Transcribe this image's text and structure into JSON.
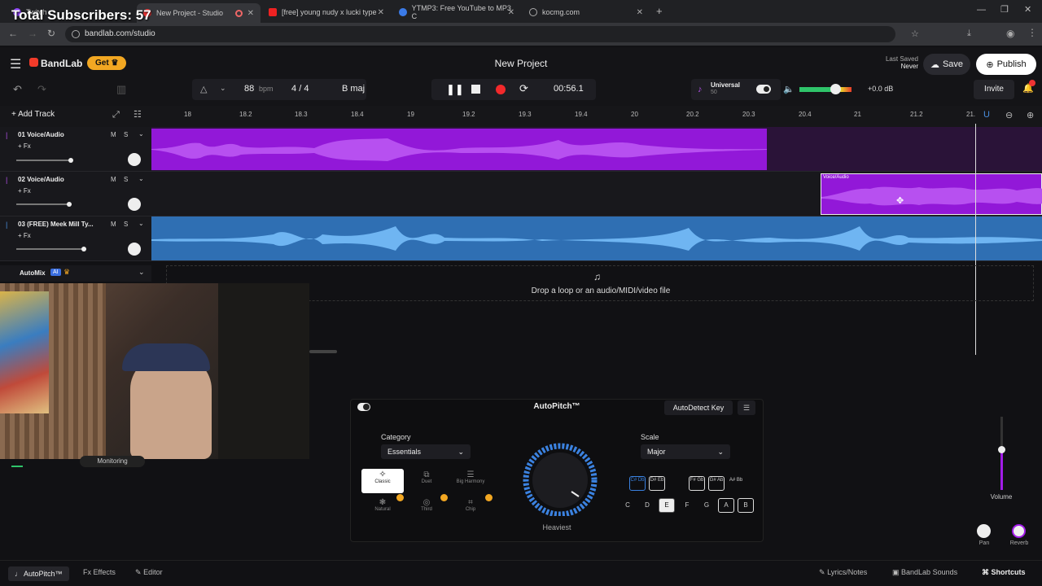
{
  "overlay": {
    "subscribers": "Total Subscribers: 57"
  },
  "browser": {
    "tabs": [
      {
        "label": "Twitch"
      },
      {
        "label": "New Project - Studio"
      },
      {
        "label": "[free] young nudy x lucki type"
      },
      {
        "label": "YTMP3: Free YouTube to MP3 C"
      },
      {
        "label": "kocmg.com"
      }
    ],
    "url": "bandlab.com/studio"
  },
  "app": {
    "brand": "BandLab",
    "get_label": "Get",
    "project_title": "New Project",
    "last_saved_label": "Last Saved",
    "last_saved_value": "Never",
    "save": "Save",
    "publish": "Publish",
    "invite": "Invite"
  },
  "transport": {
    "bpm": "88",
    "bpm_unit": "bpm",
    "sig_num": "4",
    "sig_sep": "/",
    "sig_den": "4",
    "key": "B maj",
    "time": "00:56.1",
    "universal_label": "Universal",
    "universal_value": "50",
    "master_db": "+0.0 dB"
  },
  "ruler": {
    "ticks": [
      "18",
      "18.2",
      "18.3",
      "18.4",
      "19",
      "19.2",
      "19.3",
      "19.4",
      "20",
      "20.2",
      "20.3",
      "20.4",
      "21",
      "21.2",
      "21."
    ]
  },
  "tracks": [
    {
      "name": "01  Voice/Audio",
      "fx": "+ Fx",
      "m": "M",
      "s": "S"
    },
    {
      "name": "02  Voice/Audio",
      "fx": "+ Fx",
      "m": "M",
      "s": "S",
      "clip_label": "Voice/Audio"
    },
    {
      "name": "03  (FREE) Meek Mill Ty...",
      "fx": "+ Fx",
      "m": "M",
      "s": "S"
    }
  ],
  "add_track": "Add Track",
  "automix": {
    "label": "AutoMix",
    "badge": "AI"
  },
  "drop_text": "Drop a loop or an audio/MIDI/video file",
  "monitoring": "Monitoring",
  "autopitch": {
    "title": "AutoPitch™",
    "autodetect": "AutoDetect Key",
    "category_label": "Category",
    "category_value": "Essentials",
    "scale_label": "Scale",
    "scale_value": "Major",
    "styles": [
      "Classic",
      "Duet",
      "Big Harmony",
      "Natural",
      "Third",
      "Chip"
    ],
    "knob_label": "Heaviest",
    "sharps": [
      "C# Db",
      "D# Eb",
      "F# Gb",
      "G# Ab",
      "A# Bb"
    ],
    "keys": [
      "C",
      "D",
      "E",
      "F",
      "G",
      "A",
      "B"
    ]
  },
  "right_controls": {
    "volume": "Volume",
    "pan": "Pan",
    "reverb": "Reverb"
  },
  "footer": {
    "tabs": [
      "AutoPitch™",
      "Effects",
      "Editor"
    ],
    "right": [
      "Lyrics/Notes",
      "BandLab Sounds",
      "Shortcuts"
    ]
  },
  "colors": {
    "purple": "#a21ce8",
    "blue": "#3f8ed8",
    "accent_red": "#f2292b",
    "brand_red": "#f23b2a"
  }
}
